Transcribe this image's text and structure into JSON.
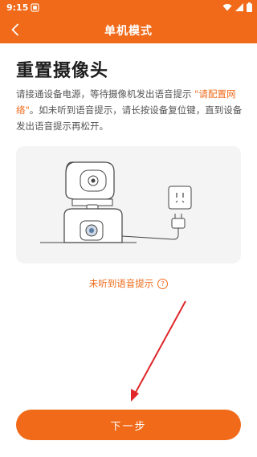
{
  "status_bar": {
    "time": "9:15",
    "icons": [
      "notification-icon",
      "wifi-icon",
      "signal-icon",
      "battery-icon"
    ]
  },
  "header": {
    "title": "单机模式",
    "back_icon": "chevron-left-icon"
  },
  "main": {
    "heading": "重置摄像头",
    "desc_part1": "请接通设备电源，等待摄像机发出语音提示 ",
    "desc_highlight": "\"请配置网络\"",
    "desc_part2": "。如未听到语音提示，请长按设备复位键，直到设备发出语音提示再松开。",
    "help_link": "未听到语音提示",
    "help_icon": "question-circle-icon"
  },
  "footer": {
    "next_label": "下一步"
  },
  "colors": {
    "accent": "#f06a19",
    "heading": "#1e1e1e",
    "body_text": "#555555",
    "illustration_bg": "#f4f4f4",
    "arrow": "#e0262a"
  }
}
